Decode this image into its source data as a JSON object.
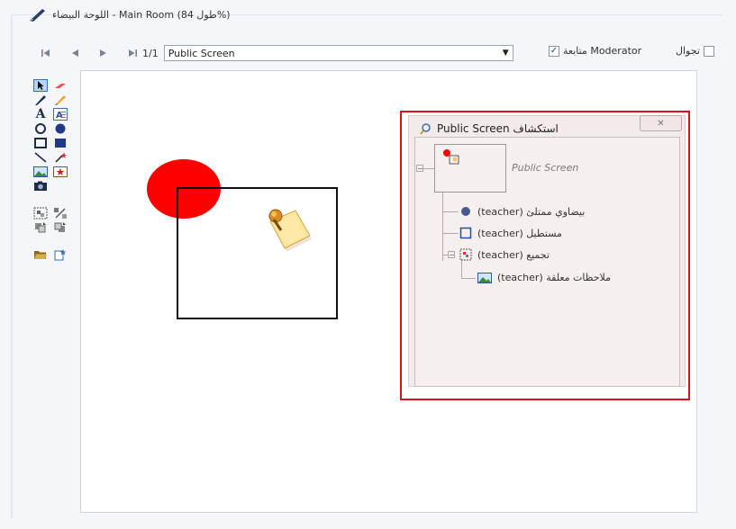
{
  "window": {
    "title": "اللوحة البيضاء - Main Room (طول 84%)",
    "pen_icon": "pen-icon"
  },
  "toolbar": {
    "first_icon": "first-page-icon",
    "prev_icon": "prev-page-icon",
    "next_icon": "next-page-icon",
    "last_icon": "last-page-icon",
    "page_number": "1/1",
    "screen_select_value": "Public Screen",
    "moderator_label": "متابعة Moderator",
    "moderator_checked": true,
    "roam_label": "تجوال",
    "roam_checked": false
  },
  "tools": [
    [
      "select-icon",
      "eraser-icon"
    ],
    [
      "pen-tool-icon",
      "highlighter-icon"
    ],
    [
      "text-icon",
      "text-box-icon"
    ],
    [
      "circle-outline-icon",
      "circle-filled-icon"
    ],
    [
      "rect-outline-icon",
      "rect-filled-icon"
    ],
    [
      "line-icon",
      "magic-wand-icon"
    ],
    [
      "image-icon",
      "sticker-icon"
    ],
    [
      "camera-icon"
    ],
    [
      "group-icon",
      "ungroup-icon"
    ],
    [
      "send-back-icon",
      "bring-front-icon"
    ],
    [
      "open-folder-icon",
      "new-page-icon"
    ]
  ],
  "canvas": {
    "shapes": [
      "red-ellipse",
      "black-rectangle",
      "sticky-note"
    ]
  },
  "explorer": {
    "title": "Public Screen استكشاف",
    "close_icon": "close-icon",
    "root_label": "Public Screen",
    "nodes": [
      {
        "label": "بيضاوي ممتلئ (teacher)",
        "icon": "filled-ellipse-icon"
      },
      {
        "label": "مستطيل (teacher)",
        "icon": "rectangle-icon"
      },
      {
        "label": "تجميع (teacher)",
        "icon": "group-icon"
      },
      {
        "label": "ملاحظات معلقة (teacher)",
        "icon": "sticky-note-icon"
      }
    ]
  },
  "colors": {
    "highlight": "#e0101a",
    "ellipse": "#ff0000",
    "explorer_bg": "#f3eaea"
  }
}
